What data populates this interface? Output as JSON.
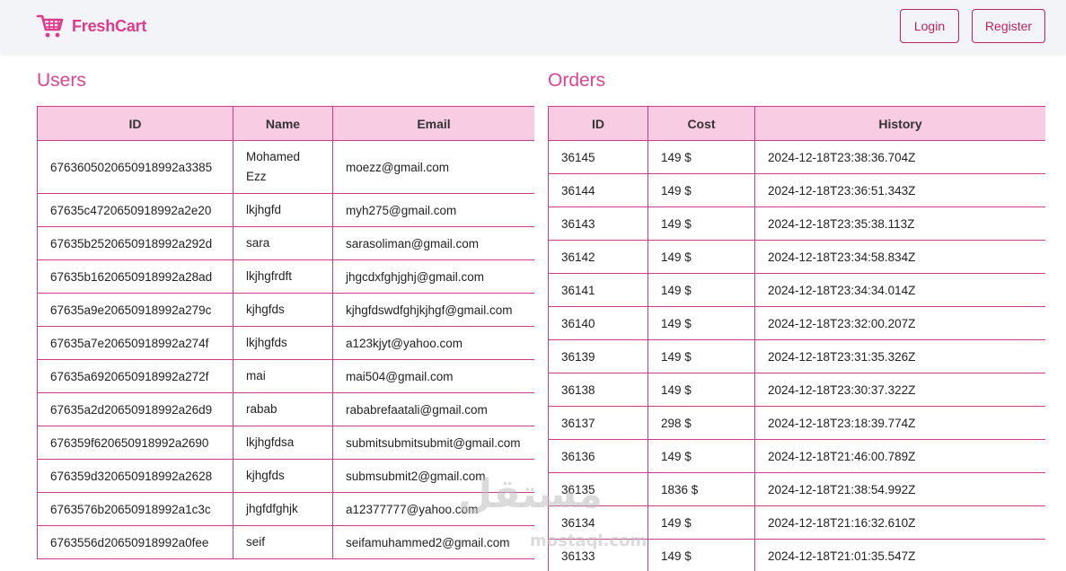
{
  "navbar": {
    "brand": "FreshCart",
    "login_label": "Login",
    "register_label": "Register"
  },
  "users": {
    "title": "Users",
    "columns": [
      "ID",
      "Name",
      "Email"
    ],
    "rows": [
      {
        "id": "6763605020650918992a3385",
        "name": "Mohamed Ezz",
        "email": "moezz@gmail.com"
      },
      {
        "id": "67635c4720650918992a2e20",
        "name": "lkjhgfd",
        "email": "myh275@gmail.com"
      },
      {
        "id": "67635b2520650918992a292d",
        "name": "sara",
        "email": "sarasoliman@gmail.com"
      },
      {
        "id": "67635b1620650918992a28ad",
        "name": "lkjhgfrdft",
        "email": "jhgcdxfghjghj@gmail.com"
      },
      {
        "id": "67635a9e20650918992a279c",
        "name": "kjhgfds",
        "email": "kjhgfdswdfghjkjhgf@gmail.com"
      },
      {
        "id": "67635a7e20650918992a274f",
        "name": "lkjhgfds",
        "email": "a123kjyt@yahoo.com"
      },
      {
        "id": "67635a6920650918992a272f",
        "name": "mai",
        "email": "mai504@gmail.com"
      },
      {
        "id": "67635a2d20650918992a26d9",
        "name": "rabab",
        "email": "rababrefaatali@gmail.com"
      },
      {
        "id": "676359f620650918992a2690",
        "name": "lkjhgfdsa",
        "email": "submitsubmitsubmit@gmail.com"
      },
      {
        "id": "676359d320650918992a2628",
        "name": "kjhgfds",
        "email": "submsubmit2@gmail.com"
      },
      {
        "id": "6763576b20650918992a1c3c",
        "name": "jhgfdfghjk",
        "email": "a12377777@yahoo.com"
      },
      {
        "id": "6763556d20650918992a0fee",
        "name": "seif",
        "email": "seifamuhammed2@gmail.com"
      }
    ]
  },
  "orders": {
    "title": "Orders",
    "columns": [
      "ID",
      "Cost",
      "History"
    ],
    "rows": [
      {
        "id": "36145",
        "cost": "149 $",
        "history": "2024-12-18T23:38:36.704Z"
      },
      {
        "id": "36144",
        "cost": "149 $",
        "history": "2024-12-18T23:36:51.343Z"
      },
      {
        "id": "36143",
        "cost": "149 $",
        "history": "2024-12-18T23:35:38.113Z"
      },
      {
        "id": "36142",
        "cost": "149 $",
        "history": "2024-12-18T23:34:58.834Z"
      },
      {
        "id": "36141",
        "cost": "149 $",
        "history": "2024-12-18T23:34:34.014Z"
      },
      {
        "id": "36140",
        "cost": "149 $",
        "history": "2024-12-18T23:32:00.207Z"
      },
      {
        "id": "36139",
        "cost": "149 $",
        "history": "2024-12-18T23:31:35.326Z"
      },
      {
        "id": "36138",
        "cost": "149 $",
        "history": "2024-12-18T23:30:37.322Z"
      },
      {
        "id": "36137",
        "cost": "298 $",
        "history": "2024-12-18T23:18:39.774Z"
      },
      {
        "id": "36136",
        "cost": "149 $",
        "history": "2024-12-18T21:46:00.789Z"
      },
      {
        "id": "36135",
        "cost": "1836 $",
        "history": "2024-12-18T21:38:54.992Z"
      },
      {
        "id": "36134",
        "cost": "149 $",
        "history": "2024-12-18T21:16:32.610Z"
      },
      {
        "id": "36133",
        "cost": "149 $",
        "history": "2024-12-18T21:01:35.547Z"
      }
    ]
  },
  "watermark": {
    "text": "مستقل",
    "sub": "mostaql.com"
  },
  "colors": {
    "brand": "#e03a8c",
    "button": "#b8245e",
    "header_bg": "#f8cde4",
    "border": "#cc3d88"
  }
}
